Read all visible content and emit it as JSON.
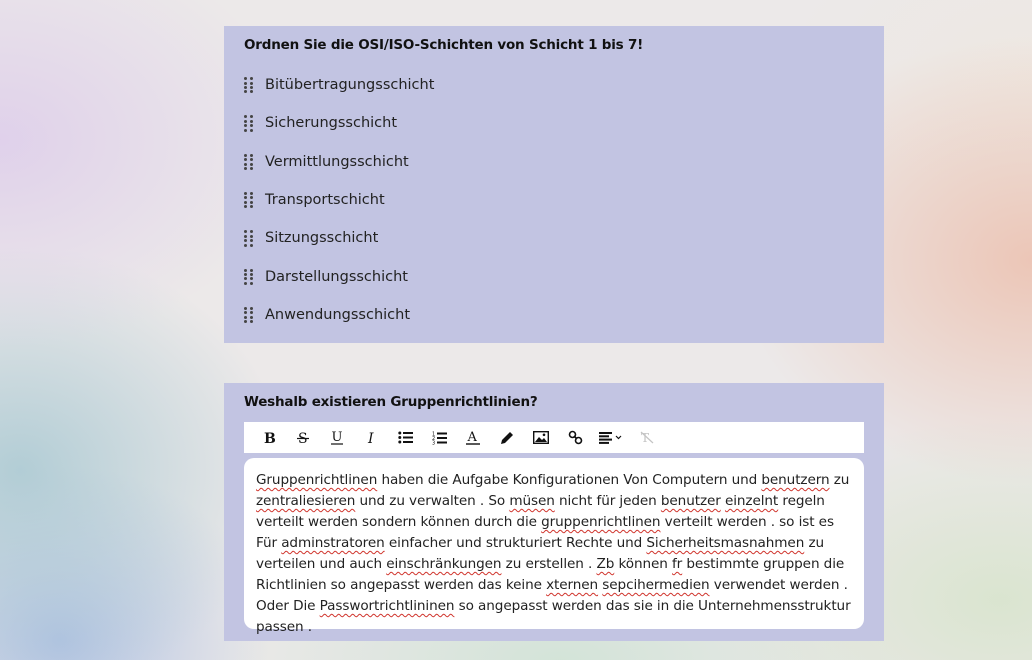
{
  "question1": {
    "title": "Ordnen Sie die OSI/ISO-Schichten von Schicht 1 bis 7!",
    "items": [
      {
        "label": "Bitübertragungsschicht"
      },
      {
        "label": "Sicherungsschicht"
      },
      {
        "label": "Vermittlungsschicht"
      },
      {
        "label": "Transportschicht"
      },
      {
        "label": "Sitzungsschicht"
      },
      {
        "label": "Darstellungsschicht"
      },
      {
        "label": "Anwendungsschicht"
      }
    ]
  },
  "question2": {
    "title": "Weshalb existieren Gruppenrichtlinien?",
    "toolbar": [
      "bold-icon",
      "strikethrough-icon",
      "underline-icon",
      "italic-icon",
      "bullet-list-icon",
      "numbered-list-icon",
      "text-color-icon",
      "highlight-pen-icon",
      "image-icon",
      "link-icon",
      "align-icon",
      "clear-format-icon"
    ],
    "answer": [
      {
        "t": "Gruppenrichtlinen",
        "s": true
      },
      {
        "t": " haben die Aufgabe  Konfigurationen Von Computern und "
      },
      {
        "t": "benutzern",
        "s": true
      },
      {
        "t": " zu "
      },
      {
        "t": "zentraliesieren",
        "s": true
      },
      {
        "t": " und zu verwalten .  So "
      },
      {
        "t": "müsen",
        "s": true
      },
      {
        "t": " nicht für jeden "
      },
      {
        "t": "benutzer",
        "s": true
      },
      {
        "t": " "
      },
      {
        "t": "einzelnt",
        "s": true
      },
      {
        "t": " regeln verteilt werden sondern können durch die "
      },
      {
        "t": "gruppenrichtlinen",
        "s": true
      },
      {
        "t": " verteilt werden . so ist es Für "
      },
      {
        "t": "adminstratoren",
        "s": true
      },
      {
        "t": " einfacher und strukturiert Rechte und "
      },
      {
        "t": "Sicherheitsmasnahmen",
        "s": true
      },
      {
        "t": " zu verteilen und auch "
      },
      {
        "t": "einschränkungen",
        "s": true
      },
      {
        "t": " zu erstellen . "
      },
      {
        "t": "Zb",
        "s": true
      },
      {
        "t": " können "
      },
      {
        "t": "fr",
        "s": true
      },
      {
        "t": " bestimmte gruppen die Richtlinien so angepasst werden das keine "
      },
      {
        "t": "xternen",
        "s": true
      },
      {
        "t": " "
      },
      {
        "t": "sepcihermedien",
        "s": true
      },
      {
        "t": " verwendet werden . Oder Die "
      },
      {
        "t": "Passwortrichtlininen",
        "s": true
      },
      {
        "t": " so angepasst werden das sie in die Unternehmensstruktur passen ."
      }
    ]
  }
}
